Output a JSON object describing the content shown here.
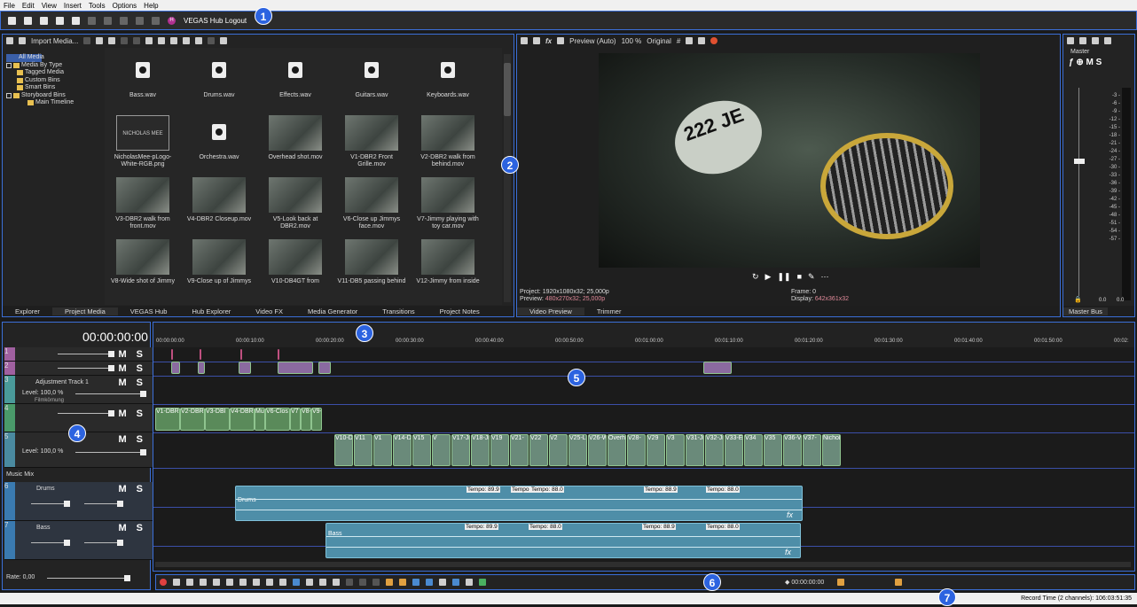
{
  "menu": [
    "File",
    "Edit",
    "View",
    "Insert",
    "Tools",
    "Options",
    "Help"
  ],
  "toolbar": {
    "hub_logout": "VEGAS Hub Logout"
  },
  "markers": [
    "1",
    "2",
    "3",
    "4",
    "5",
    "6",
    "7"
  ],
  "explorer": {
    "import_label": "Import Media...",
    "tree": [
      "All Media",
      "Media By Type",
      "Tagged Media",
      "Custom Bins",
      "Smart Bins",
      "Storyboard Bins",
      "Main Timeline"
    ]
  },
  "media": [
    {
      "name": "Bass.wav",
      "kind": "wav"
    },
    {
      "name": "Drums.wav",
      "kind": "wav"
    },
    {
      "name": "Effects.wav",
      "kind": "wav"
    },
    {
      "name": "Guitars.wav",
      "kind": "wav"
    },
    {
      "name": "Keyboards.wav",
      "kind": "wav"
    },
    {
      "name": "NicholasMee-pLogo-White-RGB.png",
      "kind": "logo",
      "logo_text": "NICHOLAS MEE"
    },
    {
      "name": "Orchestra.wav",
      "kind": "wav"
    },
    {
      "name": "Overhead shot.mov",
      "kind": "video"
    },
    {
      "name": "V1-DBR2 Front Grille.mov",
      "kind": "video"
    },
    {
      "name": "V2-DBR2 walk from behind.mov",
      "kind": "video"
    },
    {
      "name": "V3-DBR2 walk from front.mov",
      "kind": "video"
    },
    {
      "name": "V4-DBR2 Closeup.mov",
      "kind": "video"
    },
    {
      "name": "V5-Look back at DBR2.mov",
      "kind": "video"
    },
    {
      "name": "V6-Close up Jimmys face.mov",
      "kind": "video"
    },
    {
      "name": "V7-Jimmy playing with toy car.mov",
      "kind": "video"
    },
    {
      "name": "V8-Wide shot of Jimmy",
      "kind": "video"
    },
    {
      "name": "V9-Close up of Jimmys",
      "kind": "video"
    },
    {
      "name": "V10-DB4GT from",
      "kind": "video"
    },
    {
      "name": "V11-DB5 passing behind",
      "kind": "video"
    },
    {
      "name": "V12-Jimmy from inside",
      "kind": "video"
    }
  ],
  "left_tabs": [
    "Explorer",
    "Project Media",
    "VEGAS Hub",
    "Hub Explorer",
    "Video FX",
    "Media Generator",
    "Transitions",
    "Project Notes"
  ],
  "preview": {
    "mode": "Preview (Auto)",
    "zoom": "100 %",
    "original": "Original",
    "plate_text": "222 JE",
    "project_label": "Project:",
    "project_value": "1920x1080x32; 25,000p",
    "preview_label": "Preview:",
    "preview_value": "480x270x32; 25,000p",
    "frame_label": "Frame:",
    "frame_value": "0",
    "display_label": "Display:",
    "display_value": "642x361x32",
    "tabs": [
      "Video Preview",
      "Trimmer"
    ]
  },
  "master": {
    "label": "Master",
    "scale": [
      "3",
      "6",
      "9",
      "12",
      "15",
      "18",
      "21",
      "24",
      "27",
      "30",
      "33",
      "36",
      "39",
      "42",
      "45",
      "48",
      "51",
      "54",
      "57"
    ],
    "levels": [
      "0.0",
      "0.0"
    ],
    "tab": "Master Bus"
  },
  "timeline": {
    "timecode": "00:00:00:00",
    "ruler": [
      "00:00:00:00",
      "00:00:10:00",
      "00:00:20:00",
      "00:00:30:00",
      "00:00:40:00",
      "00:00:50:00",
      "00:01:00:00",
      "00:01:10:00",
      "00:01:20:00",
      "00:01:30:00",
      "00:01:40:00",
      "00:01:50:00",
      "00:02:"
    ],
    "tracks": [
      {
        "num": "1",
        "ms": "M S"
      },
      {
        "num": "2",
        "ms": "M S"
      },
      {
        "num": "3",
        "name": "Adjustment Track 1",
        "level": "Level: 100,0 %",
        "sub": "Filmkörnung",
        "ms": "M S"
      },
      {
        "num": "4",
        "ms": "M S"
      },
      {
        "num": "5",
        "level": "Level: 100,0 %",
        "ms": "M S"
      }
    ],
    "music_mix": "Music Mix",
    "audio_tracks": [
      {
        "num": "6",
        "name": "Drums",
        "ms": "M S"
      },
      {
        "num": "7",
        "name": "Bass",
        "ms": "M S"
      }
    ],
    "rate": "Rate: 0,00",
    "clips_row4": [
      "V1-DBR2",
      "V2-DBR",
      "V3-DBI",
      "V4-DBR",
      "Mu",
      "V6-Clos",
      "V7",
      "V8-",
      "V9-C"
    ],
    "clips_row5": [
      "V10-DB4GT",
      "V11",
      "V1",
      "V14-DB",
      "V15",
      "V",
      "V17-Jin",
      "V18-Ji",
      "V19",
      "V21-",
      "V22",
      "V2",
      "V25-Look",
      "V26-W",
      "Overhe",
      "V28-",
      "V29",
      "V3",
      "V31-Jin",
      "V32-Jin",
      "V33-E",
      "V34",
      "V35",
      "V36-Va",
      "V37-",
      "Nichola"
    ],
    "drums_label": "Drums",
    "bass_label": "Bass",
    "tempos_drums": [
      "Tempo: 89.9",
      "Tempo",
      "Tempo: 88.0",
      "Tempo: 88.9",
      "Tempo: 88.0"
    ],
    "tempos_bass": [
      "Tempo: 89.9",
      "Tempo: 88.0",
      "Tempo: 88.9",
      "Tempo: 88.0"
    ],
    "fx": "fx"
  },
  "transport": {
    "timecode": "00:00:00:00"
  },
  "status": {
    "record_time": "Record Time (2 channels): 106:03:51:35"
  }
}
